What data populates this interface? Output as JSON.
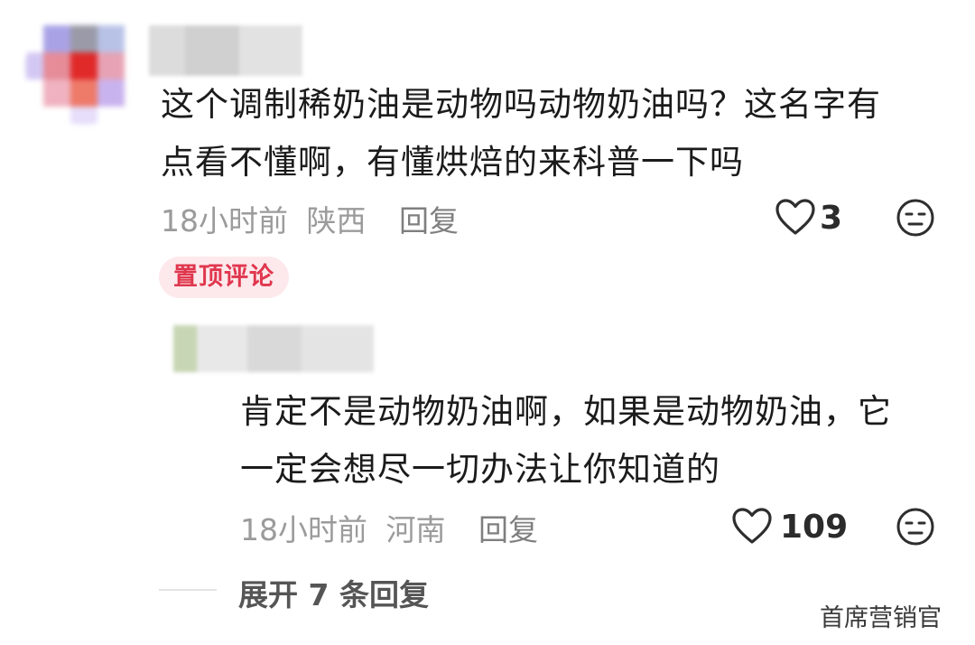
{
  "comments": [
    {
      "text_lines": [
        "这个调制稀奶油是动物吗动物奶油吗？这名字有",
        "点看不懂啊，有懂烘焙的来科普一下吗"
      ],
      "time": "18小时前",
      "location": "陕西",
      "reply_label": "回复",
      "likes": "3",
      "badge": "置顶评论"
    },
    {
      "text_lines": [
        "肯定不是动物奶油啊，如果是动物奶油，它",
        "一定会想尽一切办法让你知道的"
      ],
      "time": "18小时前",
      "location": "河南",
      "reply_label": "回复",
      "likes": "109"
    }
  ],
  "expand_label": "展开 7 条回复",
  "watermark": "首席营销官",
  "icons": {
    "like": "heart-outline-icon",
    "dislike": "neutral-face-icon"
  },
  "colors": {
    "text": "#1b1b1b",
    "meta": "#9b9b9b",
    "badge_bg": "#fde9ec",
    "badge_text": "#e0374e"
  }
}
